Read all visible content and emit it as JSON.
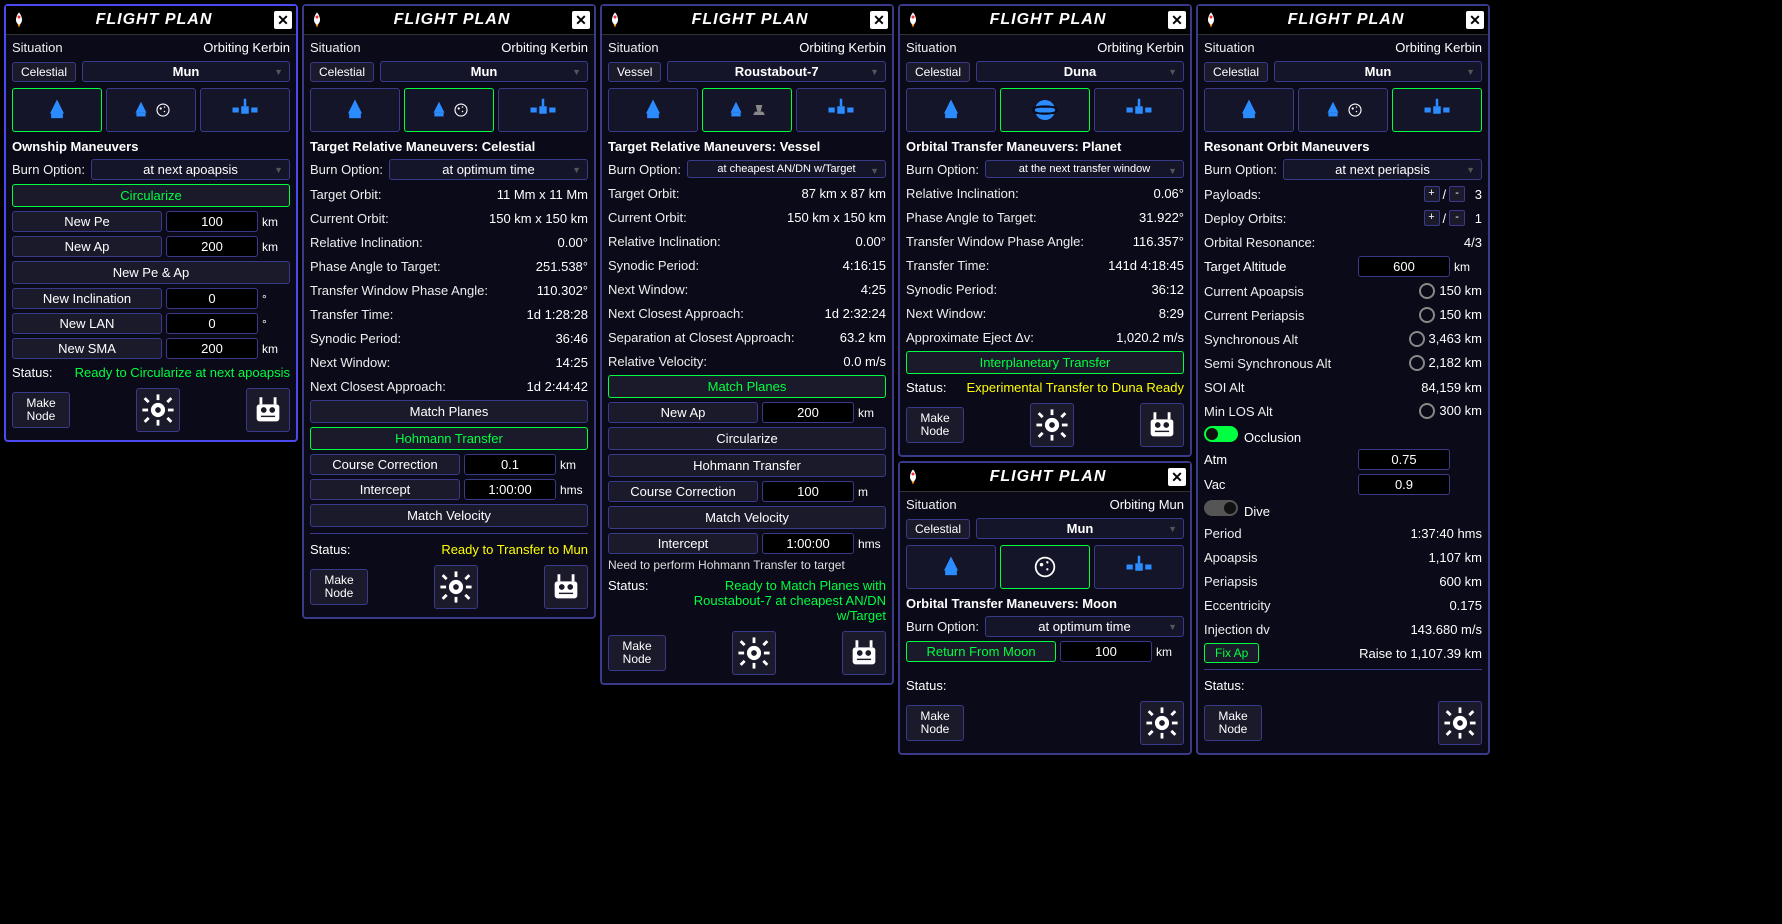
{
  "common": {
    "title": "FLIGHT PLAN",
    "situationLabel": "Situation",
    "burnOptionLabel": "Burn Option:",
    "statusLabel": "Status:",
    "makeNode": "Make\nNode",
    "celestialBtn": "Celestial",
    "vesselBtn": "Vessel"
  },
  "p1": {
    "situation": "Orbiting Kerbin",
    "target": "Mun",
    "section": "Ownship Maneuvers",
    "burnOption": "at next apoapsis",
    "circularize": "Circularize",
    "newPe": "New Pe",
    "peVal": "100",
    "peUnit": "km",
    "newAp": "New Ap",
    "apVal": "200",
    "apUnit": "km",
    "newPeAp": "New Pe & Ap",
    "newInc": "New Inclination",
    "incVal": "0",
    "incUnit": "°",
    "newLAN": "New LAN",
    "lanVal": "0",
    "lanUnit": "°",
    "newSMA": "New SMA",
    "smaVal": "200",
    "smaUnit": "km",
    "status": "Ready to Circularize at next apoapsis"
  },
  "p2": {
    "situation": "Orbiting Kerbin",
    "target": "Mun",
    "section": "Target Relative Maneuvers: Celestial",
    "burnOption": "at optimum time",
    "rows": {
      "targetOrbitL": "Target Orbit:",
      "targetOrbitV": "11 Mm x 11 Mm",
      "currentOrbitL": "Current Orbit:",
      "currentOrbitV": "150 km x 150 km",
      "relIncL": "Relative Inclination:",
      "relIncV": "0.00°",
      "phaseL": "Phase Angle to Target:",
      "phaseV": "251.538°",
      "twpaL": "Transfer Window Phase Angle:",
      "twpaV": "110.302°",
      "ttL": "Transfer Time:",
      "ttV": "1d 1:28:28",
      "synL": "Synodic Period:",
      "synV": "36:46",
      "nwL": "Next Window:",
      "nwV": "14:25",
      "ncaL": "Next Closest Approach:",
      "ncaV": "1d 2:44:42"
    },
    "matchPlanes": "Match Planes",
    "hohmann": "Hohmann Transfer",
    "courseCorr": "Course Correction",
    "ccVal": "0.1",
    "ccUnit": "km",
    "intercept": "Intercept",
    "intVal": "1:00:00",
    "intUnit": "hms",
    "matchVel": "Match Velocity",
    "status": "Ready to Transfer to Mun"
  },
  "p3": {
    "situation": "Orbiting Kerbin",
    "target": "Roustabout-7",
    "section": "Target Relative Maneuvers: Vessel",
    "burnOption": "at cheapest AN/DN w/Target",
    "rows": {
      "targetOrbitL": "Target Orbit:",
      "targetOrbitV": "87 km x 87 km",
      "currentOrbitL": "Current Orbit:",
      "currentOrbitV": "150 km x 150 km",
      "relIncL": "Relative Inclination:",
      "relIncV": "0.00°",
      "synL": "Synodic Period:",
      "synV": "4:16:15",
      "nwL": "Next Window:",
      "nwV": "4:25",
      "ncaL": "Next Closest Approach:",
      "ncaV": "1d 2:32:24",
      "sepL": "Separation at Closest Approach:",
      "sepV": "63.2 km",
      "relVL": "Relative Velocity:",
      "relVV": "0.0 m/s"
    },
    "matchPlanes": "Match Planes",
    "newAp": "New Ap",
    "apVal": "200",
    "apUnit": "km",
    "circularize": "Circularize",
    "hohmann": "Hohmann Transfer",
    "courseCorr": "Course Correction",
    "ccVal": "100",
    "ccUnit": "m",
    "matchVel": "Match Velocity",
    "intercept": "Intercept",
    "intVal": "1:00:00",
    "intUnit": "hms",
    "hint": "Need to perform Hohmann Transfer to target",
    "status": "Ready to Match Planes with Roustabout-7 at cheapest AN/DN w/Target"
  },
  "p4": {
    "situation": "Orbiting Kerbin",
    "target": "Duna",
    "section": "Orbital Transfer Maneuvers: Planet",
    "burnOption": "at the next transfer window",
    "rows": {
      "relIncL": "Relative Inclination:",
      "relIncV": "0.06°",
      "phaseL": "Phase Angle to Target:",
      "phaseV": "31.922°",
      "twpaL": "Transfer Window Phase Angle:",
      "twpaV": "116.357°",
      "ttL": "Transfer Time:",
      "ttV": "141d 4:18:45",
      "synL": "Synodic Period:",
      "synV": "36:12",
      "nwL": "Next Window:",
      "nwV": "8:29",
      "ejL": "Approximate Eject Δv:",
      "ejV": "1,020.2 m/s"
    },
    "interp": "Interplanetary Transfer",
    "status": "Experimental Transfer to Duna Ready"
  },
  "p5": {
    "situation": "Orbiting Mun",
    "target": "Mun",
    "section": "Orbital Transfer Maneuvers: Moon",
    "burnOption": "at optimum time",
    "returnBtn": "Return From Moon",
    "retVal": "100",
    "retUnit": "km",
    "status": ""
  },
  "p6": {
    "situation": "Orbiting Kerbin",
    "target": "Mun",
    "section": "Resonant Orbit Maneuvers",
    "burnOption": "at next periapsis",
    "payloadsL": "Payloads:",
    "payloadsV": "3",
    "deployL": "Deploy Orbits:",
    "deployV": "1",
    "resL": "Orbital Resonance:",
    "resV": "4/3",
    "tgtAltL": "Target Altitude",
    "tgtAltVal": "600",
    "tgtAltUnit": "km",
    "curApL": "Current Apoapsis",
    "curApV": "150 km",
    "curPeL": "Current Periapsis",
    "curPeV": "150 km",
    "syncL": "Synchronous Alt",
    "syncV": "3,463 km",
    "semiL": "Semi Synchronous Alt",
    "semiV": "2,182 km",
    "soiL": "SOI Alt",
    "soiV": "84,159 km",
    "losL": "Min LOS Alt",
    "losV": "300 km",
    "occL": "Occlusion",
    "atmL": "Atm",
    "atmV": "0.75",
    "vacL": "Vac",
    "vacV": "0.9",
    "diveL": "Dive",
    "periodL": "Period",
    "periodV": "1:37:40 hms",
    "apoL": "Apoapsis",
    "apoV": "1,107 km",
    "periL": "Periapsis",
    "periV": "600 km",
    "eccL": "Eccentricity",
    "eccV": "0.175",
    "injL": "Injection dv",
    "injV": "143.680 m/s",
    "fixAp": "Fix Ap",
    "fixHint": "Raise to 1,107.39 km",
    "status": ""
  }
}
